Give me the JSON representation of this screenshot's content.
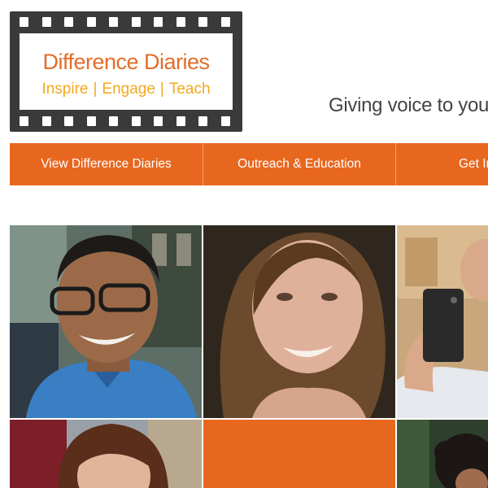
{
  "logo": {
    "title": "Difference Diaries",
    "tagline": [
      "Inspire",
      "Engage",
      "Teach"
    ],
    "separator": "|",
    "colors": {
      "frame": "#3a3a3a",
      "title": "#e36c2a",
      "tagline": "#f2a81d"
    }
  },
  "header": {
    "tagline": "Giving voice to you"
  },
  "nav": {
    "color": "#e8671f",
    "items": [
      {
        "label": "View Difference Diaries"
      },
      {
        "label": "Outreach & Education"
      },
      {
        "label": "Get In"
      }
    ]
  },
  "grid": {
    "tiles": [
      {
        "kind": "portrait",
        "subject": "smiling young man with glasses"
      },
      {
        "kind": "portrait",
        "subject": "smiling young woman with long hair"
      },
      {
        "kind": "portrait",
        "subject": "man taking mirror selfie"
      },
      {
        "kind": "portrait",
        "subject": "young woman with brown hair"
      },
      {
        "kind": "color-block",
        "color": "#e8671f"
      },
      {
        "kind": "portrait",
        "subject": "person with dark curly hair"
      }
    ]
  }
}
